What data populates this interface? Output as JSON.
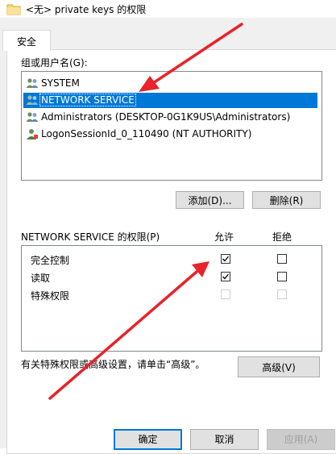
{
  "window": {
    "title": "<无> private keys 的权限",
    "folder_icon": "folder-icon"
  },
  "tabs": [
    {
      "label": "安全",
      "active": true
    }
  ],
  "groups": {
    "label": "组或用户名(G):",
    "items": [
      {
        "label": "SYSTEM",
        "icon": "users-group-icon",
        "selected": false
      },
      {
        "label": "NETWORK SERVICE",
        "icon": "users-group-icon",
        "selected": true
      },
      {
        "label": "Administrators (DESKTOP-0G1K9US\\Administrators)",
        "icon": "users-group-icon",
        "selected": false
      },
      {
        "label": "LogonSessionId_0_110490 (NT AUTHORITY)",
        "icon": "user-session-icon",
        "selected": false
      }
    ]
  },
  "buttons": {
    "add": "添加(D)...",
    "remove": "删除(R)",
    "advanced": "高级(V)",
    "ok": "确定",
    "cancel": "取消",
    "apply": "应用(A)"
  },
  "permissions": {
    "header_label": "NETWORK SERVICE 的权限(P)",
    "allow_label": "允许",
    "deny_label": "拒绝",
    "rows": [
      {
        "name": "完全控制",
        "allow": true,
        "deny": false,
        "enabled": true
      },
      {
        "name": "读取",
        "allow": true,
        "deny": false,
        "enabled": true
      },
      {
        "name": "特殊权限",
        "allow": false,
        "deny": false,
        "enabled": false
      }
    ]
  },
  "info_text": "有关特殊权限或高级设置，请单击“高级”。",
  "colors": {
    "selection": "#0078d7",
    "annotation_arrow": "#e8232a",
    "dialog_bg": "#f0f0f0"
  }
}
